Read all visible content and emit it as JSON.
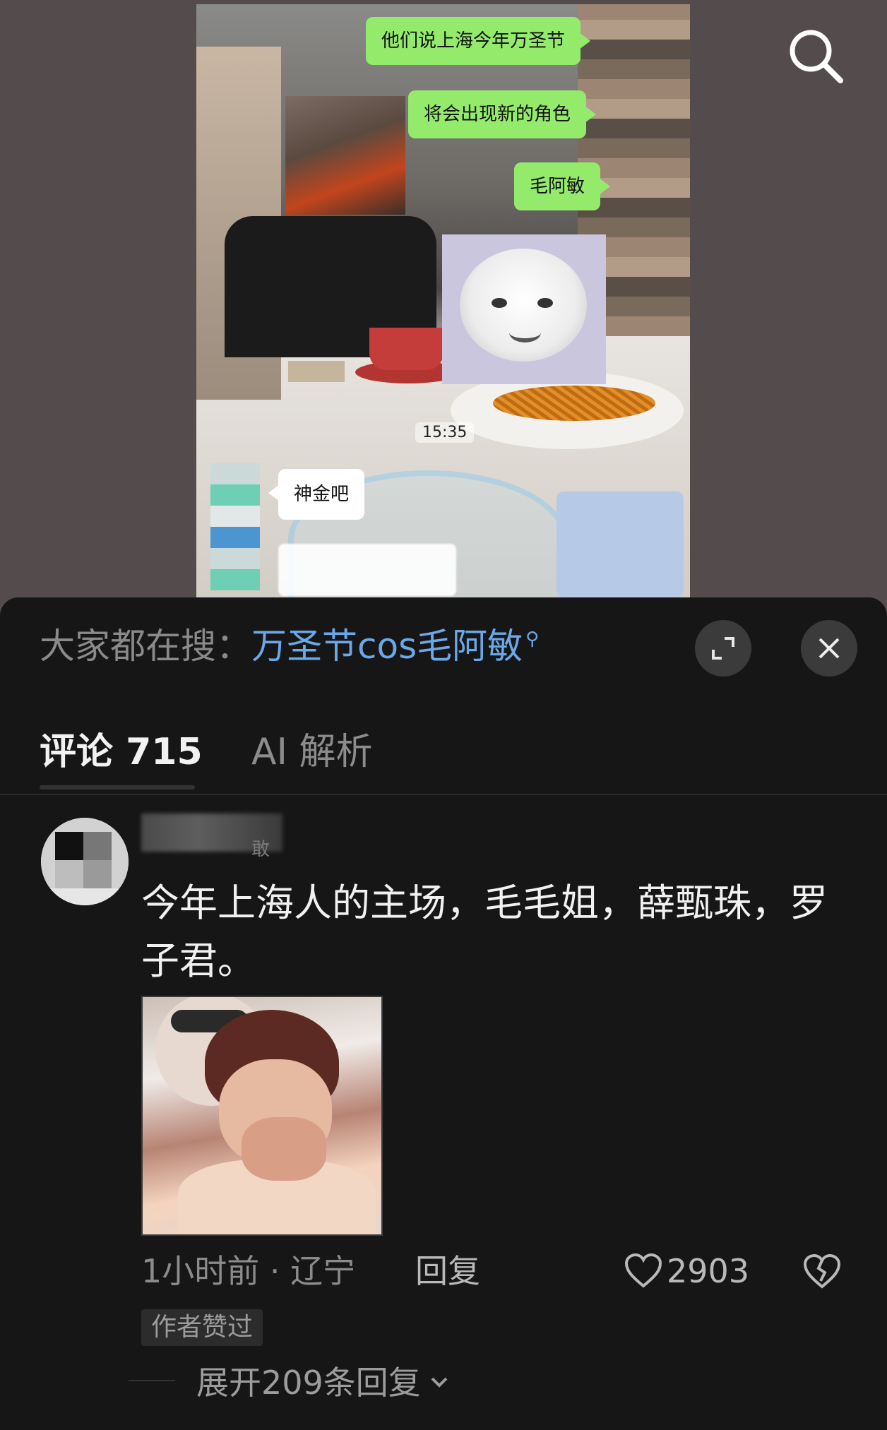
{
  "video": {
    "chat_bubbles": [
      {
        "text": "他们说上海今年万圣节",
        "side": "right"
      },
      {
        "text": "将会出现新的角色",
        "side": "right"
      },
      {
        "text": "毛阿敏",
        "side": "right"
      },
      {
        "text": "神金吧",
        "side": "left"
      }
    ],
    "timestamp": "15:35",
    "search_icon": "search-icon"
  },
  "panel": {
    "suggest_prefix": "大家都在搜：",
    "suggest_query": "万圣节cos毛阿敏",
    "suggest_icon": "small-search-icon",
    "expand_icon": "expand-icon",
    "close_icon": "close-icon",
    "tabs": {
      "comments": "评论 715",
      "ai": "AI 解析"
    }
  },
  "comment": {
    "username_suffix": "敢",
    "text": "今年上海人的主场，毛毛姐，薛甄珠，罗子君。",
    "time": "1小时前",
    "separator": " · ",
    "location": "辽宁",
    "reply_label": "回复",
    "likes": "2903",
    "badge": "作者赞过",
    "expand_replies": "展开209条回复"
  },
  "colors": {
    "link": "#6aa8e8",
    "bubble_green": "#94eb6b",
    "panel_bg": "#161616"
  }
}
